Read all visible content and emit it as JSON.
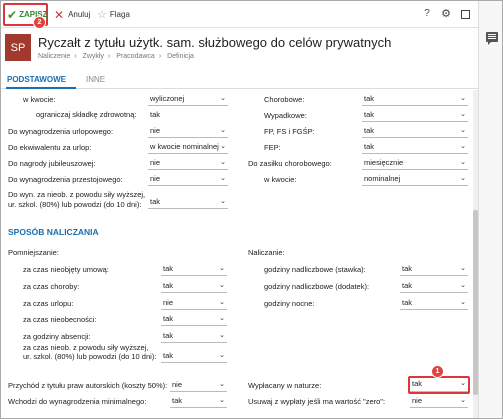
{
  "toolbar": {
    "save_label": "ZAPISZ",
    "save_badge": "2",
    "cancel_label": "Anuluj",
    "flag_label": "Flaga",
    "help_icon": "?"
  },
  "header": {
    "avatar": "SP",
    "title": "Ryczałt z tytułu użytk. sam. służbowego do celów prywatnych",
    "breadcrumb": [
      "Naliczenie",
      "Zwykły",
      "Pracodawca",
      "Definicja"
    ]
  },
  "tabs": [
    "PODSTAWOWE",
    "INNE"
  ],
  "top_fields": {
    "w_kwocie_label": "w kwocie:",
    "w_kwocie_value": "wyliczonej",
    "ograniczaj_label": "ograniczaj składkę zdrowotną:",
    "ograniczaj_value": "tak",
    "urlopowe_label": "Do wynagrodzenia urlopowego:",
    "urlopowe_value": "nie",
    "ekwiwalent_label": "Do ekwiwalentu za urlop:",
    "ekwiwalent_value": "w kwocie nominalnej",
    "jubileuszowe_label": "Do nagrody jubileuszowej:",
    "jubileuszowe_value": "nie",
    "przestojowe_label": "Do wynagrodzenia przestojowego:",
    "przestojowe_value": "nie",
    "wyn_nieob_label_1": "Do wyn. za nieob. z powodu siły wyższej,",
    "wyn_nieob_label_2": "ur. szkol. (80%) lub powodzi (do 10 dni):",
    "wyn_nieob_value": "tak",
    "chorobowe_label": "Chorobowe:",
    "chorobowe_value": "tak",
    "wypadkowe_label": "Wypadkowe:",
    "wypadkowe_value": "tak",
    "fp_label": "FP, FS i FGŚP:",
    "fp_value": "tak",
    "fep_label": "FEP:",
    "fep_value": "tak",
    "zasilek_label": "Do zasiłku chorobowego:",
    "zasilek_value": "miesięcznie",
    "zasilek_kwocie_label": "w kwocie:",
    "zasilek_kwocie_value": "nominalnej"
  },
  "section": {
    "title": "SPOSÓB NALICZANIA",
    "pomniejszanie_label": "Pomniejszanie:",
    "naliczanie_label": "Naliczanie:",
    "left_rows": [
      {
        "label": "za czas nieobjęty umową:",
        "value": "tak"
      },
      {
        "label": "za czas choroby:",
        "value": "tak"
      },
      {
        "label": "za czas urlopu:",
        "value": "nie"
      },
      {
        "label": "za czas nieobecności:",
        "value": "tak"
      },
      {
        "label": "za godziny absencji:",
        "value": "tak"
      }
    ],
    "left_multi_label_1": "za czas nieob. z powodu siły wyższej,",
    "left_multi_label_2": "ur. szkol. (80%) lub powodzi (do 10 dni):",
    "left_multi_value": "tak",
    "right_rows": [
      {
        "label": "godziny nadliczbowe (stawka):",
        "value": "tak"
      },
      {
        "label": "godziny nadliczbowe (dodatek):",
        "value": "tak"
      },
      {
        "label": "godziny nocne:",
        "value": "tak"
      }
    ],
    "autorskie_label": "Przychód z tytułu praw autorskich (koszty 50%):",
    "autorskie_value": "nie",
    "minimalne_label": "Wchodzi do wynagrodzenia minimalnego:",
    "minimalne_value": "tak",
    "wyplacany_label": "Wypłacany w naturze:",
    "wyplacany_value": "tak",
    "wyplacany_badge": "1",
    "usuwaj_label": "Usuwaj z wypłaty jeśli ma wartość \"zero\":",
    "usuwaj_value": "nie"
  },
  "colors": {
    "accent": "#1a6fb0",
    "avatar_bg": "#a0392e",
    "highlight": "#d9363e",
    "save_green": "#2e8b2e"
  }
}
